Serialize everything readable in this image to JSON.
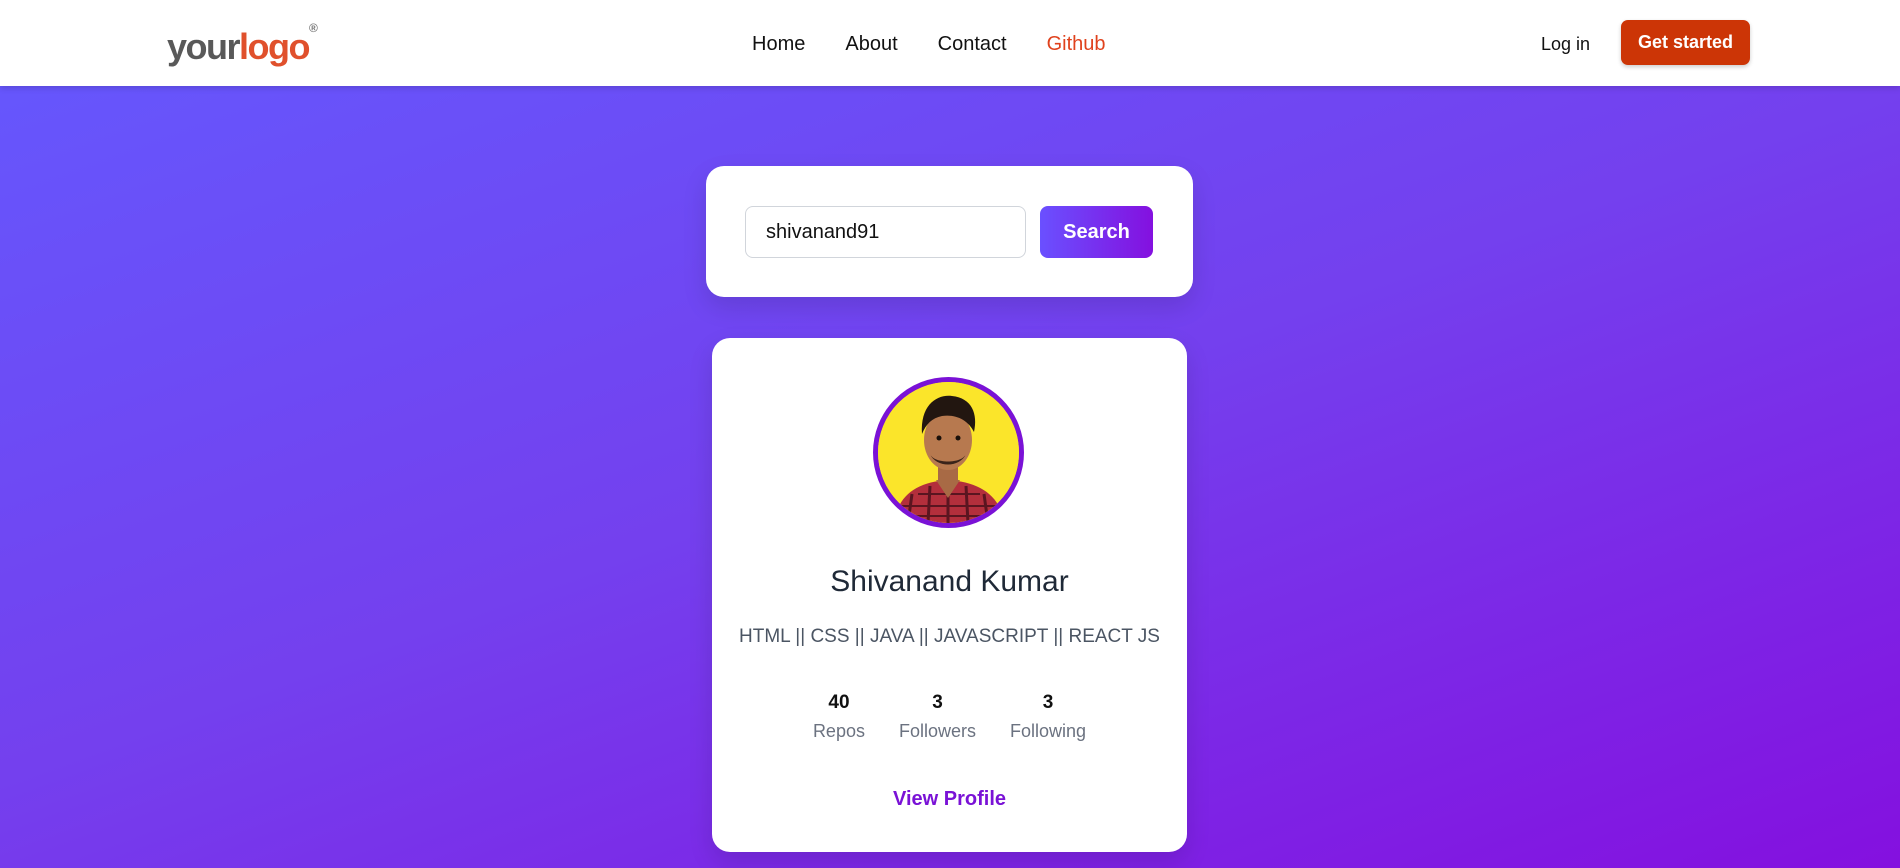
{
  "header": {
    "logo": {
      "part1": "your",
      "part2": "logo",
      "mark": "®"
    },
    "nav": [
      {
        "label": "Home"
      },
      {
        "label": "About"
      },
      {
        "label": "Contact"
      },
      {
        "label": "Github"
      }
    ],
    "active_nav": "Github",
    "login_label": "Log in",
    "cta_label": "Get started"
  },
  "search": {
    "input_value": "shivanand91",
    "button_label": "Search"
  },
  "profile": {
    "name": "Shivanand Kumar",
    "bio": "HTML || CSS || JAVA || JAVASCRIPT || REACT JS",
    "stats": [
      {
        "value": "40",
        "label": "Repos"
      },
      {
        "value": "3",
        "label": "Followers"
      },
      {
        "value": "3",
        "label": "Following"
      }
    ],
    "link_label": "View Profile"
  },
  "colors": {
    "accent": "#7a12d6",
    "cta": "#cc3506",
    "active_nav": "#e0421d",
    "avatar_bg": "#fbe52a"
  }
}
